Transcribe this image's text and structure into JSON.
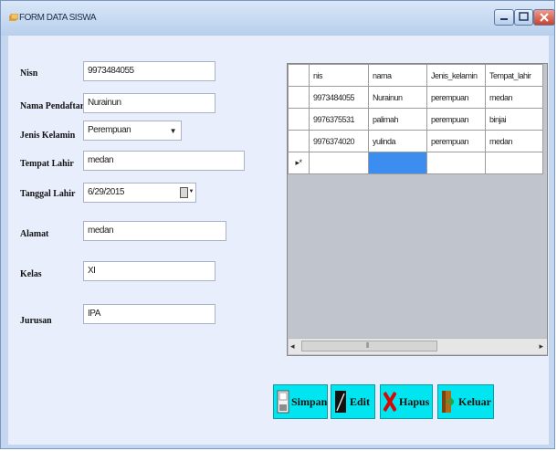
{
  "window": {
    "title": "FORM DATA SISWA"
  },
  "form": {
    "nisn": {
      "label": "Nisn",
      "value": "9973484055"
    },
    "nama": {
      "label": "Nama Pendaftar",
      "value": "Nurainun"
    },
    "jenis": {
      "label": "Jenis Kelamin",
      "value": "Perempuan"
    },
    "tempat": {
      "label": "Tempat Lahir",
      "value": "medan"
    },
    "tanggal": {
      "label": "Tanggal Lahir",
      "value": "6/29/2015"
    },
    "alamat": {
      "label": "Alamat",
      "value": "medan"
    },
    "kelas": {
      "label": "Kelas",
      "value": "XI"
    },
    "jurusan": {
      "label": "Jurusan",
      "value": "IPA"
    }
  },
  "grid": {
    "columns": [
      "nis",
      "nama",
      "Jenis_kelamin",
      "Tempat_lahir"
    ],
    "rows": [
      [
        "9973484055",
        "Nurainun",
        "perempuan",
        "medan"
      ],
      [
        "9976375531",
        "palimah",
        "perempuan",
        "binjai"
      ],
      [
        "9976374020",
        "yulinda",
        "perempuan",
        "medan"
      ]
    ],
    "new_row_marker": "▸*"
  },
  "buttons": {
    "simpan": "Simpan",
    "edit": "Edit",
    "hapus": "Hapus",
    "keluar": "Keluar"
  },
  "colors": {
    "button_bg": "#00e5ef",
    "selected_cell": "#3b8df0"
  },
  "icons": {
    "app": "form-icon",
    "simpan": "save-icon",
    "edit": "pencil-icon",
    "hapus": "delete-x-icon",
    "keluar": "exit-door-icon"
  }
}
